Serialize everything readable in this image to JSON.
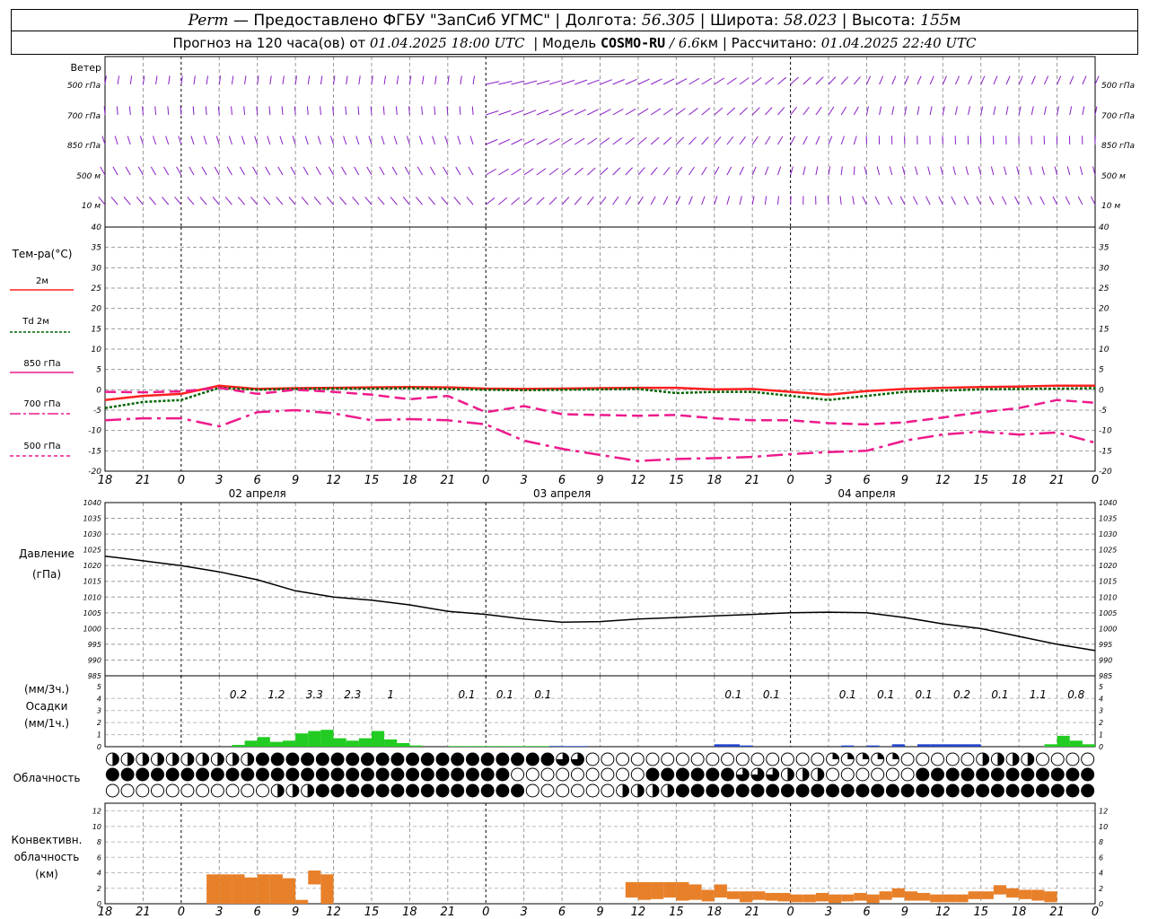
{
  "header": {
    "station": "Perm",
    "provider": "— Предоставлено ФГБУ \"ЗапСиб УГМС\"",
    "lon_label": "Долгота:",
    "lon": "56.305",
    "lat_label": "Широта:",
    "lat": "58.023",
    "alt_label": "Высота:",
    "alt": "155",
    "alt_unit": "м",
    "forecast_label": "Прогноз на 120 часа(ов) от",
    "forecast_time": "01.04.2025 18:00 UTC",
    "model_label": "Модель",
    "model_name": "COSMO-RU",
    "model_res": "/ 6.6",
    "model_res_unit": "км",
    "computed_label": "Рассчитано:",
    "computed_time": "01.04.2025 22:40 UTC"
  },
  "hour_ticks": [
    "18",
    "21",
    "0",
    "3",
    "6",
    "9",
    "12",
    "15",
    "18",
    "21",
    "0",
    "3",
    "6",
    "9",
    "12",
    "15",
    "18",
    "21",
    "0",
    "3",
    "6",
    "9",
    "12",
    "15",
    "18",
    "21",
    "0"
  ],
  "day_labels": [
    "02 апреля",
    "03 апреля",
    "04 апреля"
  ],
  "wind_panel": {
    "title": "Ветер",
    "levels": [
      "500 гПа",
      "700 гПа",
      "850 гПа",
      "500 м",
      "10 м"
    ]
  },
  "temp_panel": {
    "title": "Тем-ра(°C)",
    "legend": [
      "2м",
      "Td 2м",
      "850 гПа",
      "700 гПа",
      "500 гПа"
    ]
  },
  "pressure_panel": {
    "title_1": "Давление",
    "title_2": "(гПа)"
  },
  "precip_panel": {
    "title_1": "(мм/3ч.)",
    "title_2": "Осадки",
    "title_3": "(мм/1ч.)",
    "sum_labels": [
      {
        "hour": 12,
        "text": "0.2"
      },
      {
        "hour": 15,
        "text": "1.2"
      },
      {
        "hour": 18,
        "text": "3.3"
      },
      {
        "hour": 21,
        "text": "2.3"
      },
      {
        "hour": 24,
        "text": "1"
      },
      {
        "hour": 30,
        "text": "0.1"
      },
      {
        "hour": 33,
        "text": "0.1"
      },
      {
        "hour": 36,
        "text": "0.1"
      },
      {
        "hour": 51,
        "text": "0.1"
      },
      {
        "hour": 54,
        "text": "0.1"
      },
      {
        "hour": 60,
        "text": "0.1"
      },
      {
        "hour": 63,
        "text": "0.1"
      },
      {
        "hour": 66,
        "text": "0.1"
      },
      {
        "hour": 69,
        "text": "0.2"
      },
      {
        "hour": 72,
        "text": "0.1"
      },
      {
        "hour": 75,
        "text": "1.1"
      },
      {
        "hour": 78,
        "text": "0.8"
      }
    ]
  },
  "cloud_panel": {
    "title": "Облачность"
  },
  "conv_panel": {
    "title_1": "Конвективн.",
    "title_2": "облачность",
    "title_3": "(км)"
  },
  "colors": {
    "t2m": "#ff2020",
    "td": "#006400",
    "t850": "#ee1a8c",
    "precip_rain": "#22cc22",
    "precip_snow": "#2244cc",
    "conv": "#e8802a",
    "wind": "#8a1fc8"
  },
  "chart_data": [
    {
      "type": "line",
      "title": "Тем-ра(°C)",
      "x_unit": "hours from 01.04.2025 18:00 UTC",
      "ylim": [
        -20,
        40
      ],
      "series": [
        {
          "name": "2м",
          "x": [
            0,
            3,
            6,
            9,
            12,
            15,
            18,
            21,
            24,
            27,
            30,
            33,
            36,
            39,
            42,
            45,
            48,
            51,
            54,
            57,
            60,
            63,
            66,
            69,
            72,
            75,
            78
          ],
          "values": [
            -2.5,
            -1.5,
            -1,
            1,
            0.2,
            0.4,
            0.5,
            0.6,
            0.7,
            0.6,
            0.3,
            0.2,
            0.3,
            0.4,
            0.5,
            0.5,
            0.1,
            0.2,
            -0.5,
            -1.2,
            -0.3,
            0.2,
            0.5,
            0.7,
            0.8,
            1,
            1
          ]
        },
        {
          "name": "Td 2м",
          "x": [
            0,
            3,
            6,
            9,
            12,
            15,
            18,
            21,
            24,
            27,
            30,
            33,
            36,
            39,
            42,
            45,
            48,
            51,
            54,
            57,
            60,
            63,
            66,
            69,
            72,
            75,
            78
          ],
          "values": [
            -4.5,
            -3,
            -2.5,
            0.5,
            0,
            0.2,
            0.3,
            0.3,
            0.4,
            0.2,
            0,
            -0.1,
            0,
            0.1,
            0.2,
            -0.8,
            -0.5,
            -0.5,
            -1.5,
            -2.5,
            -1.5,
            -0.5,
            -0.2,
            0.1,
            0.2,
            0.3,
            0.4
          ]
        },
        {
          "name": "850 гПа",
          "x": [
            0,
            3,
            6,
            9,
            12,
            15,
            18,
            21,
            24,
            27,
            30,
            33,
            36,
            39,
            42,
            45,
            48,
            51,
            54,
            57,
            60,
            63,
            66,
            69,
            72,
            75,
            78
          ],
          "values": [
            -0.5,
            -0.6,
            -0.4,
            0.5,
            -1,
            0,
            -0.5,
            -1.2,
            -2.3,
            -1.5,
            -5.5,
            -4,
            -6,
            -6.2,
            -6.4,
            -6.2,
            -7,
            -7.5,
            -7.5,
            -8.2,
            -8.5,
            -8,
            -6.8,
            -5.5,
            -4.5,
            -2.5,
            -3.2
          ]
        },
        {
          "name": "700 гПа",
          "x": [
            0,
            3,
            6,
            9,
            12,
            15,
            18,
            21,
            24,
            27,
            30,
            33,
            36,
            39,
            42,
            45,
            48,
            51,
            54,
            57,
            60,
            63,
            66,
            69,
            72,
            75,
            78
          ],
          "values": [
            -7.5,
            -7,
            -7,
            -9,
            -5.5,
            -5,
            -5.8,
            -7.5,
            -7.2,
            -7.5,
            -8.5,
            -12.5,
            -14.5,
            -16,
            -17.5,
            -17,
            -16.8,
            -16.5,
            -15.8,
            -15.3,
            -15,
            -12.5,
            -11,
            -10.3,
            -11,
            -10.5,
            -13
          ]
        }
      ]
    },
    {
      "type": "line",
      "title": "Давление (гПа)",
      "x_unit": "hours from 01.04.2025 18:00 UTC",
      "ylim": [
        985,
        1040
      ],
      "series": [
        {
          "name": "Давление",
          "x": [
            0,
            3,
            6,
            9,
            12,
            15,
            18,
            21,
            24,
            27,
            30,
            33,
            36,
            39,
            42,
            45,
            48,
            51,
            54,
            57,
            60,
            63,
            66,
            69,
            72,
            75,
            78
          ],
          "values": [
            1023,
            1021.5,
            1020,
            1018,
            1015.5,
            1012,
            1010,
            1009,
            1007.5,
            1005.5,
            1004.5,
            1003,
            1002,
            1002.2,
            1003,
            1003.5,
            1004,
            1004.5,
            1005,
            1005.2,
            1005,
            1003.5,
            1001.5,
            1000,
            997.5,
            995,
            993
          ]
        }
      ]
    },
    {
      "type": "bar",
      "title": "Осадки (мм/1ч.)",
      "x_unit": "hours from 01.04.2025 18:00 UTC",
      "ylim": [
        0,
        5
      ],
      "series": [
        {
          "name": "rain",
          "x": [
            11,
            12,
            13,
            14,
            15,
            16,
            17,
            18,
            19,
            20,
            21,
            22,
            23,
            24,
            25,
            28,
            29,
            30,
            31,
            32,
            33,
            34,
            35,
            36,
            75,
            76,
            77,
            78
          ],
          "values": [
            0.15,
            0.5,
            0.8,
            0.4,
            0.5,
            1.1,
            1.3,
            1.4,
            0.7,
            0.5,
            0.7,
            1.3,
            0.6,
            0.3,
            0.1,
            0.05,
            0.05,
            0.05,
            0.05,
            0.05,
            0.05,
            0.05,
            0.05,
            0.05,
            0.2,
            0.9,
            0.5,
            0.2
          ]
        },
        {
          "name": "snow",
          "x": [
            36,
            37,
            38,
            49,
            50,
            51,
            59,
            61,
            63,
            65,
            66,
            67,
            68,
            69
          ],
          "values": [
            0.05,
            0.05,
            0.05,
            0.2,
            0.2,
            0.1,
            0.1,
            0.1,
            0.2,
            0.2,
            0.2,
            0.2,
            0.2,
            0.2
          ]
        }
      ]
    },
    {
      "type": "bar",
      "title": "Конвективн. облачность (км)",
      "x_unit": "hours from 01.04.2025 18:00 UTC",
      "ylim": [
        0,
        13
      ],
      "series": [
        {
          "name": "conv",
          "x": [
            9,
            10,
            11,
            12,
            13,
            14,
            15,
            16,
            17,
            18,
            42,
            43,
            44,
            45,
            46,
            47,
            48,
            49,
            50,
            51,
            52,
            53,
            54,
            55,
            56,
            57,
            58,
            59,
            60,
            61,
            62,
            63,
            64,
            65,
            66,
            67,
            68,
            69,
            70,
            71,
            72,
            73,
            74,
            75
          ],
          "values": [
            [
              3.8,
              0
            ],
            [
              3.8,
              0
            ],
            [
              3.8,
              0
            ],
            [
              3.4,
              0
            ],
            [
              3.8,
              0
            ],
            [
              3.8,
              0
            ],
            [
              3.3,
              0
            ],
            [
              0.5,
              0
            ],
            [
              4.3,
              2.5
            ],
            [
              3.8,
              0
            ],
            [
              2.8,
              0.8
            ],
            [
              2.8,
              0.5
            ],
            [
              2.8,
              0.6
            ],
            [
              2.8,
              0.8
            ],
            [
              2.8,
              0.4
            ],
            [
              2.5,
              0.5
            ],
            [
              1.8,
              0.3
            ],
            [
              2.5,
              0.8
            ],
            [
              1.6,
              0.6
            ],
            [
              1.6,
              0.2
            ],
            [
              1.6,
              0.5
            ],
            [
              1.4,
              0.4
            ],
            [
              1.4,
              0.3
            ],
            [
              1.2,
              0.2
            ],
            [
              1.2,
              0.2
            ],
            [
              1.4,
              0.3
            ],
            [
              1.2,
              0.1
            ],
            [
              1.2,
              0.3
            ],
            [
              1.4,
              0.4
            ],
            [
              1.2,
              0.1
            ],
            [
              1.6,
              0.5
            ],
            [
              2.0,
              0.8
            ],
            [
              1.6,
              0.4
            ],
            [
              1.4,
              0.4
            ],
            [
              1.2,
              0.2
            ],
            [
              1.2,
              0.2
            ],
            [
              1.2,
              0.2
            ],
            [
              1.6,
              0.6
            ],
            [
              1.6,
              0.6
            ],
            [
              2.4,
              1.2
            ],
            [
              2.0,
              0.8
            ],
            [
              1.8,
              0.6
            ],
            [
              1.8,
              0.4
            ],
            [
              1.6,
              0.2
            ]
          ]
        }
      ]
    }
  ]
}
